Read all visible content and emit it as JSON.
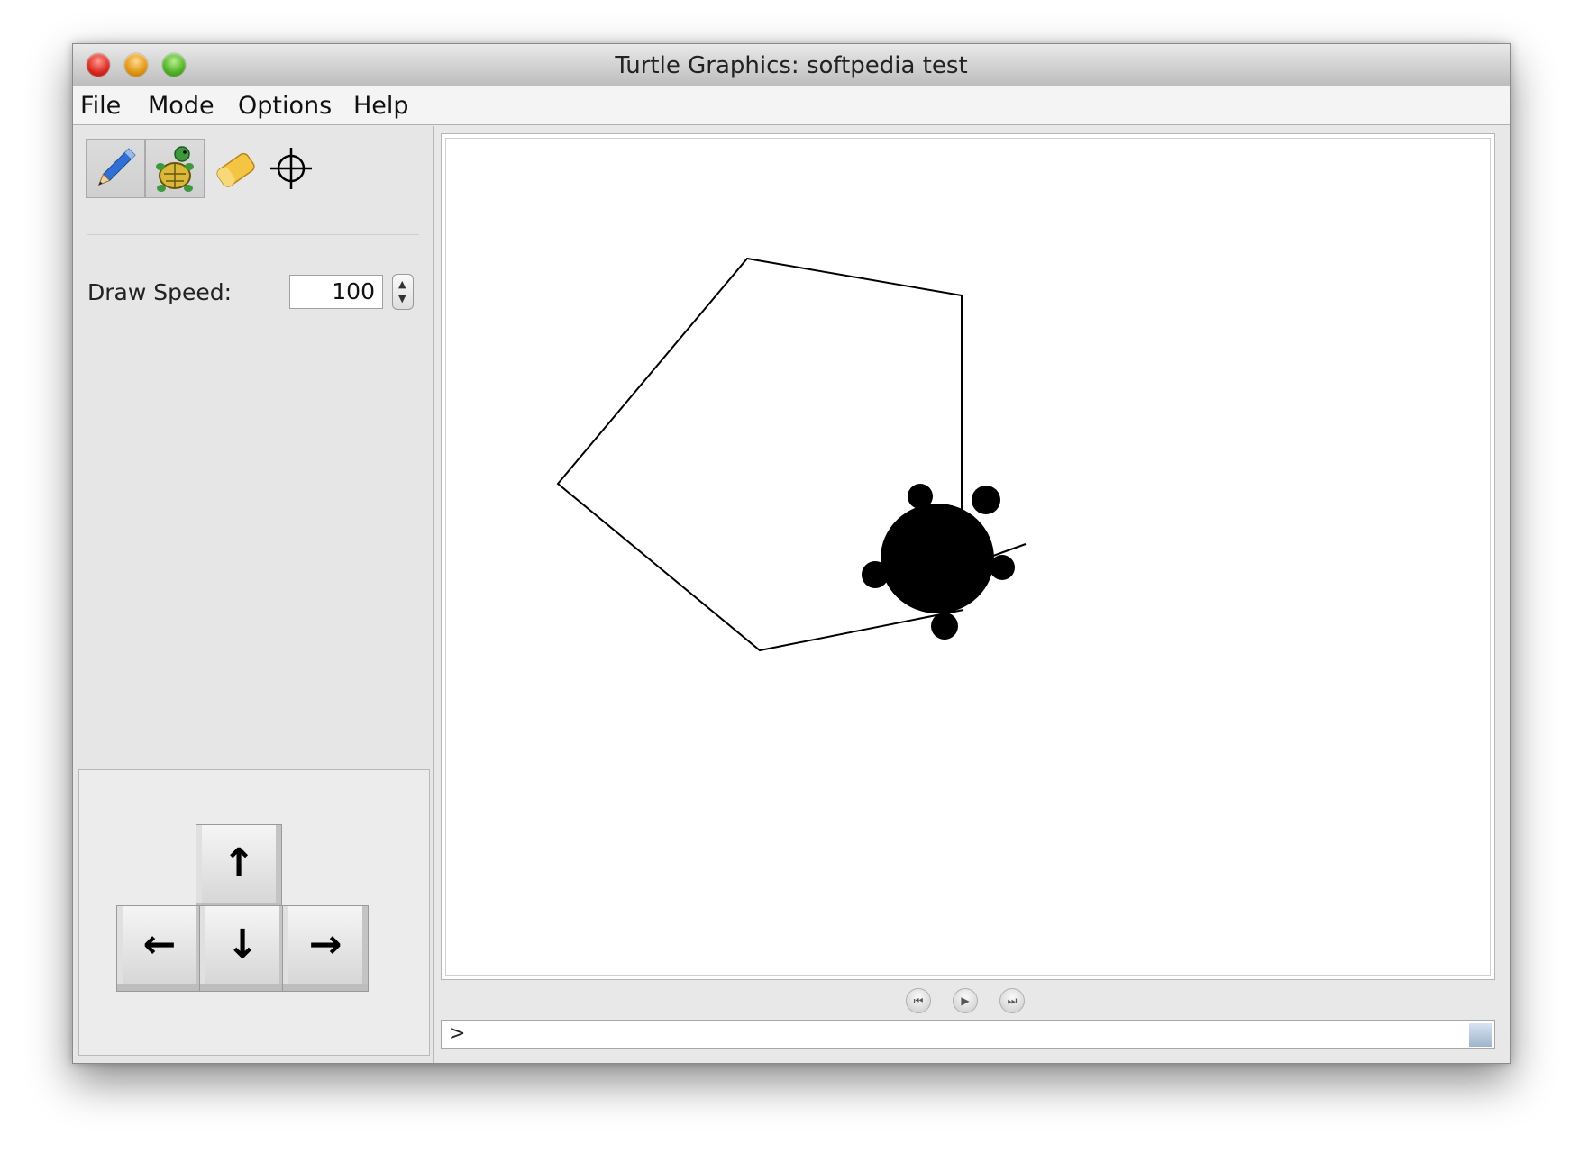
{
  "window": {
    "title": "Turtle Graphics: softpedia test"
  },
  "menu": {
    "items": [
      "File",
      "Mode",
      "Options",
      "Help"
    ]
  },
  "toolbar": {
    "tools": [
      {
        "icon": "pencil-icon",
        "pressed": true
      },
      {
        "icon": "turtle-icon",
        "pressed": true
      },
      {
        "icon": "eraser-icon",
        "pressed": false
      },
      {
        "icon": "crosshair-icon",
        "pressed": false
      }
    ]
  },
  "speed": {
    "label": "Draw Speed:",
    "value": "100"
  },
  "arrows": {
    "up": "↑",
    "left": "←",
    "down": "↓",
    "right": "→"
  },
  "playback": {
    "rewind": "⏮",
    "play": "▶",
    "forward": "⏭"
  },
  "command": {
    "prompt": ">"
  },
  "colors": {
    "stroke": "#000000",
    "turtle": "#000000"
  }
}
